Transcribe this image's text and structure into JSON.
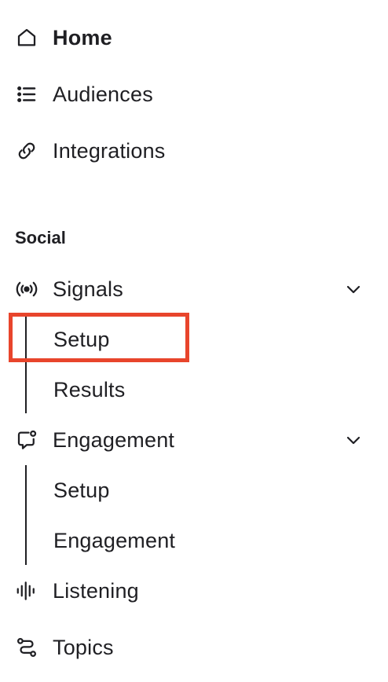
{
  "nav": {
    "home": {
      "label": "Home",
      "icon": "home-icon"
    },
    "audiences": {
      "label": "Audiences",
      "icon": "list-icon"
    },
    "integrations": {
      "label": "Integrations",
      "icon": "link-icon"
    }
  },
  "social": {
    "section_label": "Social",
    "signals": {
      "label": "Signals",
      "icon": "broadcast-icon",
      "expanded": true,
      "children": [
        {
          "label": "Setup",
          "highlighted": true
        },
        {
          "label": "Results"
        }
      ]
    },
    "engagement": {
      "label": "Engagement",
      "icon": "chat-bubble-icon",
      "expanded": true,
      "children": [
        {
          "label": "Setup"
        },
        {
          "label": "Engagement"
        }
      ]
    },
    "listening": {
      "label": "Listening",
      "icon": "waveform-icon"
    },
    "topics": {
      "label": "Topics",
      "icon": "route-icon"
    }
  },
  "colors": {
    "text": "#1f1f23",
    "highlight_border": "#e8452c"
  }
}
